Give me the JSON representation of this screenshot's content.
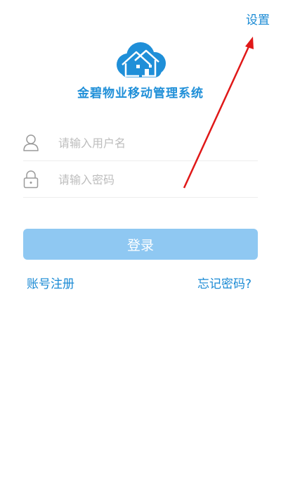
{
  "header": {
    "settings_label": "设置"
  },
  "branding": {
    "app_title": "金碧物业移动管理系统",
    "accent_color": "#1f8fd8"
  },
  "login_form": {
    "username_placeholder": "请输入用户名",
    "password_placeholder": "请输入密码",
    "login_label": "登录",
    "button_color": "#8fc8f2"
  },
  "links": {
    "register_label": "账号注册",
    "forgot_label": "忘记密码?"
  },
  "icons": {
    "logo": "cloud-house-icon",
    "username": "user-icon",
    "password": "lock-icon"
  }
}
